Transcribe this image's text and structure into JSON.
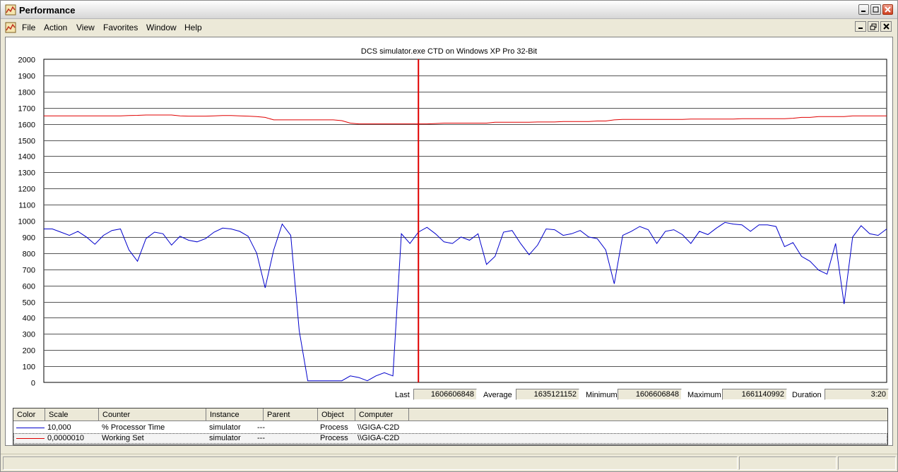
{
  "window": {
    "title": "Performance"
  },
  "menu": [
    "File",
    "Action",
    "View",
    "Favorites",
    "Window",
    "Help"
  ],
  "chart_title": "DCS simulator.exe CTD on Windows XP Pro 32-Bit",
  "stats": {
    "last_label": "Last",
    "last": "1606606848",
    "avg_label": "Average",
    "avg": "1635121152",
    "min_label": "Minimum",
    "min": "1606606848",
    "max_label": "Maximum",
    "max": "1661140992",
    "dur_label": "Duration",
    "dur": "3:20"
  },
  "legend": {
    "headers": [
      "Color",
      "Scale",
      "Counter",
      "Instance",
      "Parent",
      "Object",
      "Computer"
    ],
    "rows": [
      {
        "color": "#0000cc",
        "scale": "10,000",
        "counter": "% Processor Time",
        "instance": "simulator",
        "parent": "---",
        "object": "Process",
        "computer": "\\\\GIGA-C2D"
      },
      {
        "color": "#e00000",
        "scale": "0,0000010",
        "counter": "Working Set",
        "instance": "simulator",
        "parent": "---",
        "object": "Process",
        "computer": "\\\\GIGA-C2D"
      }
    ]
  },
  "chart_data": {
    "type": "line",
    "title": "DCS simulator.exe CTD on Windows XP Pro 32-Bit",
    "ylim": [
      0,
      2000
    ],
    "yticks": [
      0,
      100,
      200,
      300,
      400,
      500,
      600,
      700,
      800,
      900,
      1000,
      1100,
      1200,
      1300,
      1400,
      1500,
      1600,
      1700,
      1800,
      1900,
      2000
    ],
    "grid": true,
    "cursor_index": 44,
    "series": [
      {
        "name": "% Processor Time",
        "color": "#0000cc",
        "values": [
          950,
          950,
          930,
          910,
          935,
          900,
          855,
          910,
          940,
          950,
          820,
          750,
          890,
          930,
          920,
          850,
          905,
          880,
          870,
          890,
          930,
          955,
          950,
          935,
          905,
          800,
          585,
          820,
          980,
          910,
          320,
          10,
          10,
          10,
          10,
          10,
          40,
          30,
          10,
          40,
          60,
          40,
          920,
          860,
          930,
          960,
          920,
          870,
          860,
          900,
          880,
          920,
          730,
          780,
          930,
          940,
          860,
          790,
          850,
          950,
          945,
          910,
          920,
          940,
          900,
          890,
          820,
          610,
          910,
          935,
          965,
          945,
          860,
          935,
          945,
          915,
          860,
          935,
          915,
          955,
          990,
          980,
          975,
          935,
          975,
          975,
          965,
          840,
          865,
          780,
          750,
          695,
          670,
          860,
          485,
          900,
          970,
          920,
          910,
          950
        ]
      },
      {
        "name": "Working Set",
        "color": "#e00000",
        "values": [
          1650,
          1650,
          1650,
          1650,
          1650,
          1650,
          1650,
          1650,
          1650,
          1650,
          1652,
          1653,
          1655,
          1655,
          1655,
          1655,
          1650,
          1648,
          1648,
          1648,
          1650,
          1652,
          1652,
          1650,
          1648,
          1645,
          1640,
          1625,
          1625,
          1625,
          1625,
          1625,
          1625,
          1625,
          1625,
          1620,
          1605,
          1600,
          1600,
          1600,
          1600,
          1600,
          1600,
          1600,
          1600,
          1600,
          1602,
          1605,
          1605,
          1605,
          1605,
          1605,
          1605,
          1610,
          1610,
          1610,
          1610,
          1610,
          1612,
          1612,
          1612,
          1615,
          1615,
          1615,
          1615,
          1618,
          1618,
          1625,
          1628,
          1628,
          1628,
          1628,
          1628,
          1628,
          1628,
          1628,
          1630,
          1630,
          1630,
          1630,
          1630,
          1630,
          1632,
          1632,
          1632,
          1632,
          1632,
          1632,
          1635,
          1640,
          1640,
          1645,
          1645,
          1645,
          1645,
          1650,
          1650,
          1650,
          1650,
          1650
        ]
      }
    ]
  }
}
